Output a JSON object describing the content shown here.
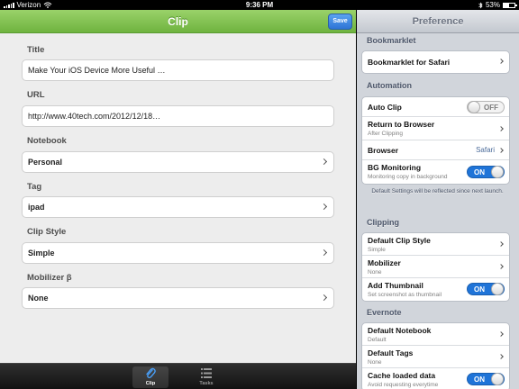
{
  "status": {
    "carrier": "Verizon",
    "time": "9:36 PM",
    "battery": "53%"
  },
  "clip": {
    "title": "Clip",
    "save_label": "Save",
    "fields": [
      {
        "label": "Title",
        "value": "Make Your iOS Device More Useful …"
      },
      {
        "label": "URL",
        "value": "http://www.40tech.com/2012/12/18…"
      },
      {
        "label": "Notebook",
        "value": "Personal"
      },
      {
        "label": "Tag",
        "value": "ipad"
      },
      {
        "label": "Clip Style",
        "value": "Simple"
      },
      {
        "label": "Mobilizer β",
        "value": "None"
      }
    ],
    "tabs": [
      {
        "label": "Clip",
        "icon": "paperclip-icon"
      },
      {
        "label": "Tasks",
        "icon": "list-icon"
      }
    ]
  },
  "preference": {
    "title": "Preference",
    "bookmarklet": {
      "header": "Bookmarklet",
      "item": "Bookmarklet for Safari"
    },
    "automation": {
      "header": "Automation",
      "auto_clip": {
        "label": "Auto Clip",
        "toggle": "OFF"
      },
      "return_to_browser": {
        "label": "Return to Browser",
        "sub": "After Clipping"
      },
      "browser": {
        "label": "Browser",
        "value": "Safari"
      },
      "bg_monitoring": {
        "label": "BG Monitoring",
        "sub": "Monitoring copy in background",
        "toggle": "ON"
      },
      "note": "Default Settings will be reflected since next launch."
    },
    "clipping": {
      "header": "Clipping",
      "default_clip_style": {
        "label": "Default Clip Style",
        "sub": "Simple"
      },
      "mobilizer": {
        "label": "Mobilizer",
        "sub": "None"
      },
      "add_thumbnail": {
        "label": "Add Thumbnail",
        "sub": "Set screenshot as thumbnail",
        "toggle": "ON"
      }
    },
    "evernote": {
      "header": "Evernote",
      "default_notebook": {
        "label": "Default Notebook",
        "sub": "Default"
      },
      "default_tags": {
        "label": "Default Tags",
        "sub": "None"
      },
      "cache": {
        "label": "Cache loaded data",
        "sub": "Avoid requesting everytime",
        "toggle": "ON"
      }
    }
  },
  "colors": {
    "accent_green": "#7cbf4b",
    "save_blue": "#2e74d6",
    "toggle_blue": "#1f74d8"
  }
}
